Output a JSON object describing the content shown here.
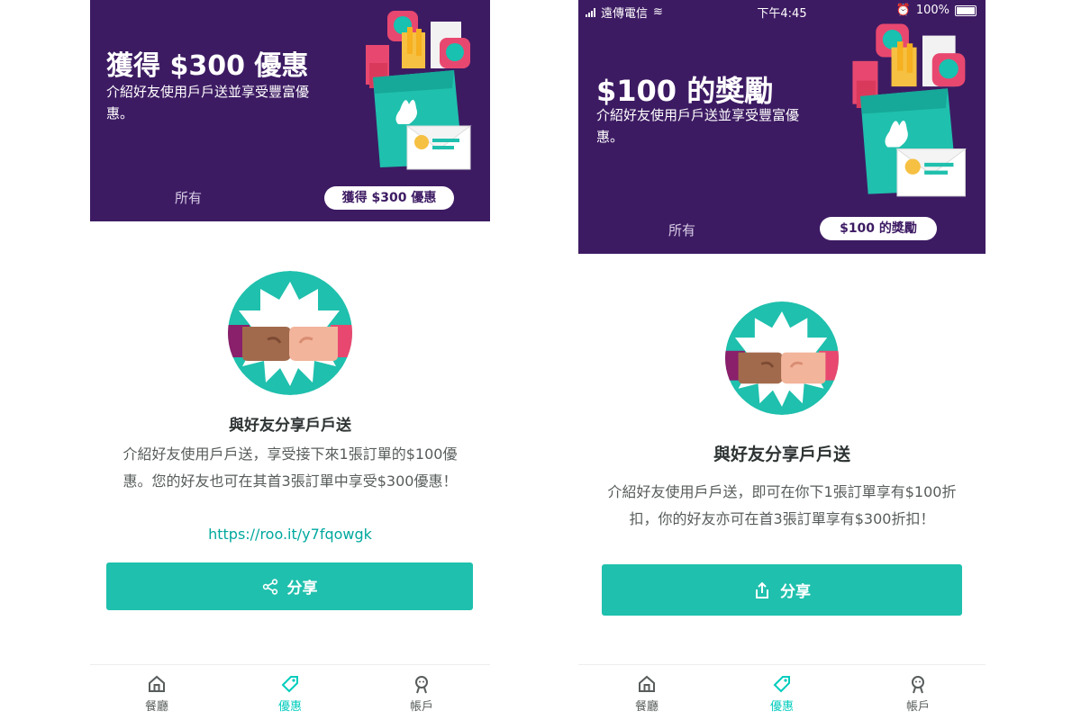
{
  "colors": {
    "brand_purple": "#3d1b63",
    "teal": "#00ccbc",
    "button_teal": "#1fc0ad",
    "text_dark": "#2e3333",
    "text_muted": "#585c5c",
    "link": "#00a89e"
  },
  "left": {
    "banner": {
      "title": "獲得 $300 優惠",
      "description": "介紹好友使用戶戶送並享受豐富優惠。",
      "filter_all": "所有",
      "filter_selected": "獲得 $300 優惠"
    },
    "share": {
      "title": "與好友分享戶戶送",
      "description": "介紹好友使用戶戶送，享受接下來1張訂單的$100優惠。您的好友也可在其首3張訂單中享受$300優惠！",
      "link": "https://roo.it/y7fqowgk",
      "button_label": "分享",
      "button_icon": "share-nodes-icon"
    },
    "tabbar": [
      {
        "label": "餐廳",
        "icon": "home-icon"
      },
      {
        "label": "優惠",
        "icon": "tag-icon",
        "active": true
      },
      {
        "label": "帳戶",
        "icon": "account-icon"
      }
    ]
  },
  "right": {
    "statusbar": {
      "carrier": "遠傳電信",
      "time": "下午4:45",
      "battery": "100%"
    },
    "banner": {
      "title": "$100 的獎勵",
      "description": "介紹好友使用戶戶送並享受豐富優惠。",
      "filter_all": "所有",
      "filter_selected": "$100 的獎勵"
    },
    "share": {
      "title": "與好友分享戶戶送",
      "description": "介紹好友使用戶戶送，即可在你下1張訂單享有$100折扣，你的好友亦可在首3張訂單享有$300折扣！",
      "button_label": "分享",
      "button_icon": "share-upload-icon"
    },
    "tabbar": [
      {
        "label": "餐廳",
        "icon": "home-icon"
      },
      {
        "label": "優惠",
        "icon": "tag-icon",
        "active": true
      },
      {
        "label": "帳戶",
        "icon": "account-icon"
      }
    ]
  }
}
